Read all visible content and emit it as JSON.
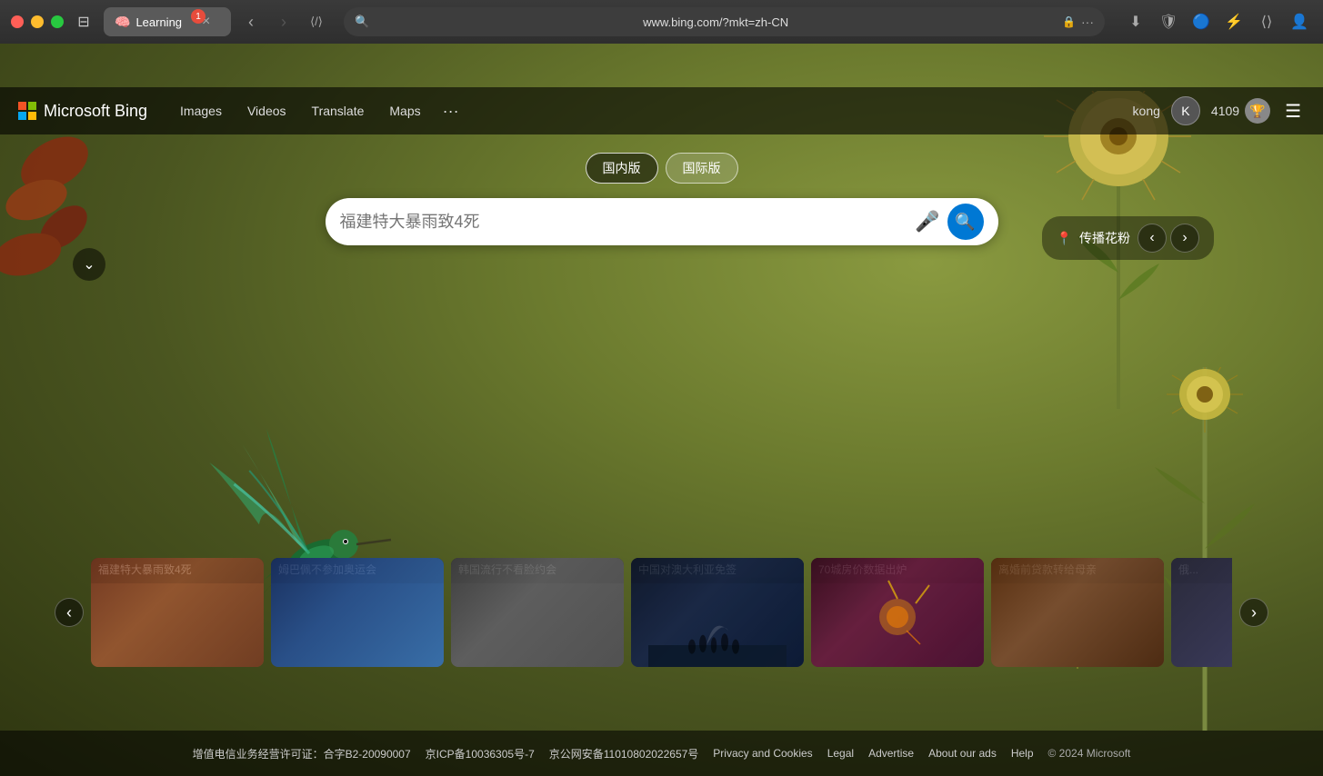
{
  "titlebar": {
    "tab_label": "Learning",
    "tab_badge": "1",
    "url": "www.bing.com/?mkt=zh-CN"
  },
  "bing_nav": {
    "logo_text": "Microsoft Bing",
    "links": [
      "Images",
      "Videos",
      "Translate",
      "Maps"
    ],
    "more_label": "···",
    "user_name": "kong",
    "points": "4109",
    "hamburger": "☰"
  },
  "search": {
    "region_tabs": [
      "国内版",
      "国际版"
    ],
    "active_tab": "国内版",
    "placeholder": "福建特大暴雨致4死",
    "mic_label": "🎤",
    "search_label": "🔍"
  },
  "bg_info": {
    "location": "传播花粉",
    "location_icon": "📍"
  },
  "news_cards": [
    {
      "id": 1,
      "title": "福建特大暴雨致4死",
      "color_class": "nc1"
    },
    {
      "id": 2,
      "title": "姆巴佩不参加奥运会",
      "color_class": "nc2"
    },
    {
      "id": 3,
      "title": "韩国流行不看脸约会",
      "color_class": "nc3"
    },
    {
      "id": 4,
      "title": "中国对澳大利亚免签",
      "color_class": "nc4"
    },
    {
      "id": 5,
      "title": "70城房价数据出炉",
      "color_class": "nc5"
    },
    {
      "id": 6,
      "title": "离婚前贷款转给母亲",
      "color_class": "nc6"
    },
    {
      "id": 7,
      "title": "俄...",
      "color_class": "nc7"
    }
  ],
  "footer": {
    "links": [
      "增值电信业务经营许可证：合字B2-20090007",
      "京ICP备10036305号-7",
      "京公网安备11010802022657号",
      "Privacy and Cookies",
      "Legal",
      "Advertise",
      "About our ads",
      "Help"
    ],
    "copyright": "© 2024 Microsoft"
  }
}
